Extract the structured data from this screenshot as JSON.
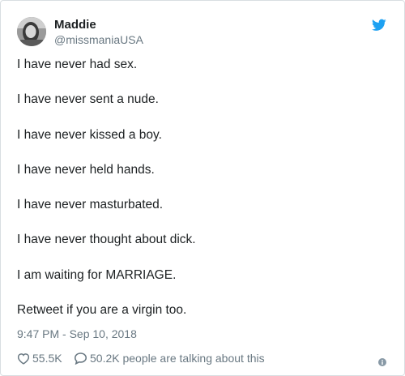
{
  "tweet": {
    "author": {
      "display_name": "Maddie",
      "handle": "@missmaniaUSA",
      "avatar_icon": "profile-photo"
    },
    "brand_icon": "twitter-bird-icon",
    "lines": [
      "I have never had sex.",
      "I have never sent a nude.",
      "I have never kissed a boy.",
      "I have never held hands.",
      "I have never masturbated.",
      "I have never thought about dick.",
      "I am waiting for MARRIAGE.",
      "Retweet if you are a virgin too."
    ],
    "timestamp": "9:47 PM - Sep 10, 2018",
    "likes": "55.5K",
    "replies_text": "50.2K people are talking about this",
    "info_icon": "info-icon"
  },
  "colors": {
    "text": "#1c2022",
    "muted": "#697882",
    "twitter_blue": "#1da1f2",
    "border": "#d9dee2"
  }
}
